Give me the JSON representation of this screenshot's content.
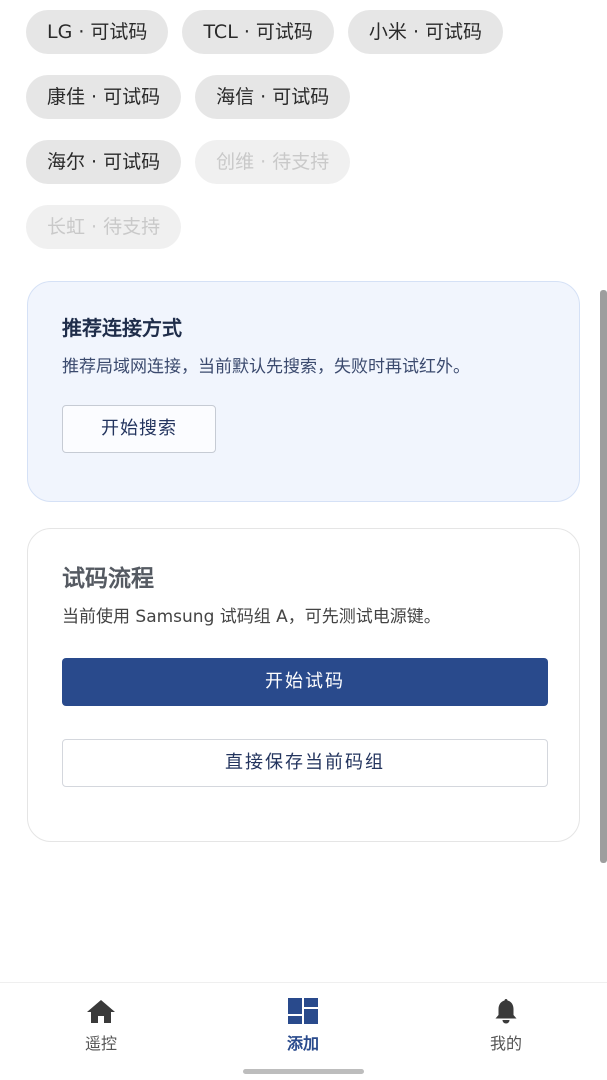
{
  "brands": {
    "rows": [
      [
        {
          "label": "LG · 可试码",
          "enabled": true
        },
        {
          "label": "TCL · 可试码",
          "enabled": true
        },
        {
          "label": "小米 · 可试码",
          "enabled": true
        }
      ],
      [
        {
          "label": "康佳 · 可试码",
          "enabled": true
        },
        {
          "label": "海信 · 可试码",
          "enabled": true
        }
      ],
      [
        {
          "label": "海尔 · 可试码",
          "enabled": true
        },
        {
          "label": "创维 · 待支持",
          "enabled": false
        }
      ],
      [
        {
          "label": "长虹 · 待支持",
          "enabled": false
        }
      ]
    ]
  },
  "recommend_card": {
    "title": "推荐连接方式",
    "description": "推荐局域网连接，当前默认先搜索，失败时再试红外。",
    "button_label": "开始搜索"
  },
  "trial_card": {
    "title": "试码流程",
    "description": "当前使用 Samsung 试码组 A，可先测试电源键。",
    "primary_button_label": "开始试码",
    "secondary_button_label": "直接保存当前码组"
  },
  "bottom_nav": {
    "items": [
      {
        "label": "遥控",
        "icon": "home-icon",
        "active": false
      },
      {
        "label": "添加",
        "icon": "dashboard-icon",
        "active": true
      },
      {
        "label": "我的",
        "icon": "bell-icon",
        "active": false
      }
    ]
  },
  "colors": {
    "primary": "#294a8c",
    "card_blue_bg": "#f1f5fd",
    "chip_bg": "#e6e6e6"
  }
}
